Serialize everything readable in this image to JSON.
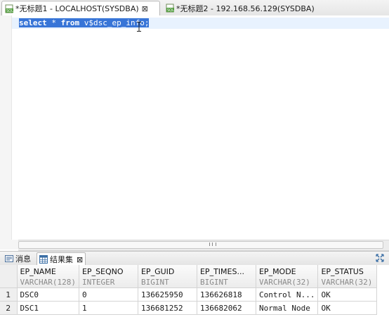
{
  "editor_tabs": [
    {
      "label": "*无标题1 - LOCALHOST(SYSDBA)",
      "active": true,
      "close": "⊠"
    },
    {
      "label": "*无标题2 - 192.168.56.129(SYSDBA)",
      "active": false
    }
  ],
  "editor": {
    "sql_keyword_select": "select",
    "sql_star": " * ",
    "sql_keyword_from": "from",
    "sql_rest": " v$dsc_ep_info;"
  },
  "result_panel": {
    "tabs": [
      {
        "label": "消息",
        "active": false
      },
      {
        "label": "结果集",
        "active": true,
        "close": "⊠"
      }
    ]
  },
  "result_grid": {
    "columns": [
      {
        "name": "EP_NAME",
        "type": "VARCHAR(128)"
      },
      {
        "name": "EP_SEQNO",
        "type": "INTEGER"
      },
      {
        "name": "EP_GUID",
        "type": "BIGINT"
      },
      {
        "name": "EP_TIMES...",
        "type": "BIGINT"
      },
      {
        "name": "EP_MODE",
        "type": "VARCHAR(32)"
      },
      {
        "name": "EP_STATUS",
        "type": "VARCHAR(32)"
      }
    ],
    "rows": [
      {
        "num": "1",
        "cells": [
          "DSC0",
          "0",
          "136625950",
          "136626818",
          "Control N...",
          "OK"
        ]
      },
      {
        "num": "2",
        "cells": [
          "DSC1",
          "1",
          "136681252",
          "136682062",
          "Normal Node",
          "OK"
        ]
      }
    ]
  },
  "colors": {
    "selection": "#3875d7",
    "current_line": "#e8f2fe"
  }
}
